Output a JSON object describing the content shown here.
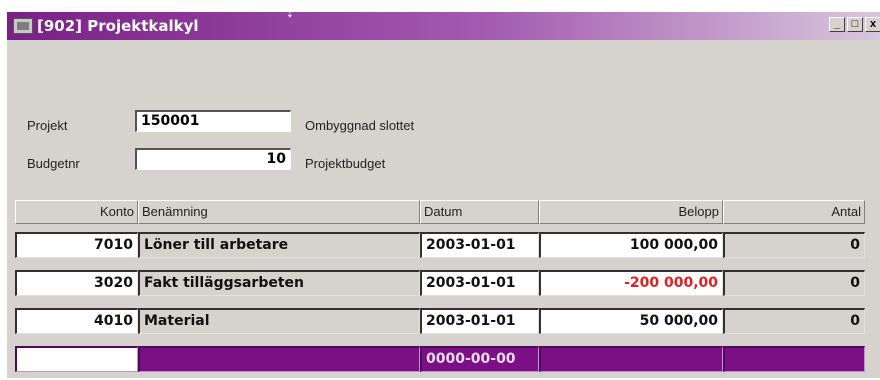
{
  "window": {
    "title": "[902] Projektkalkyl",
    "buttons": {
      "minimize": "_",
      "maximize": "□",
      "close": "x"
    }
  },
  "form": {
    "projekt_label": "Projekt",
    "projekt_value": "150001",
    "projekt_desc": "Ombyggnad slottet",
    "budget_label": "Budgetnr",
    "budget_value": "10",
    "budget_desc": "Projektbudget"
  },
  "grid": {
    "headers": [
      "Konto",
      "Benämning",
      "Datum",
      "Belopp",
      "Antal"
    ],
    "rows": [
      {
        "konto": "7010",
        "benamning": "Löner till arbetare",
        "datum": "2003-01-01",
        "belopp": "100 000,00",
        "antal": "0",
        "negative": false
      },
      {
        "konto": "3020",
        "benamning": "Fakt tilläggsarbeten",
        "datum": "2003-01-01",
        "belopp": "-200 000,00",
        "antal": "0",
        "negative": true
      },
      {
        "konto": "4010",
        "benamning": "Material",
        "datum": "2003-01-01",
        "belopp": "50 000,00",
        "antal": "0",
        "negative": false
      }
    ],
    "new_row": {
      "datum": "0000-00-00"
    }
  },
  "colors": {
    "accent": "#7a0f86",
    "negative": "#e02020",
    "window_bg": "#d6d3ce"
  }
}
